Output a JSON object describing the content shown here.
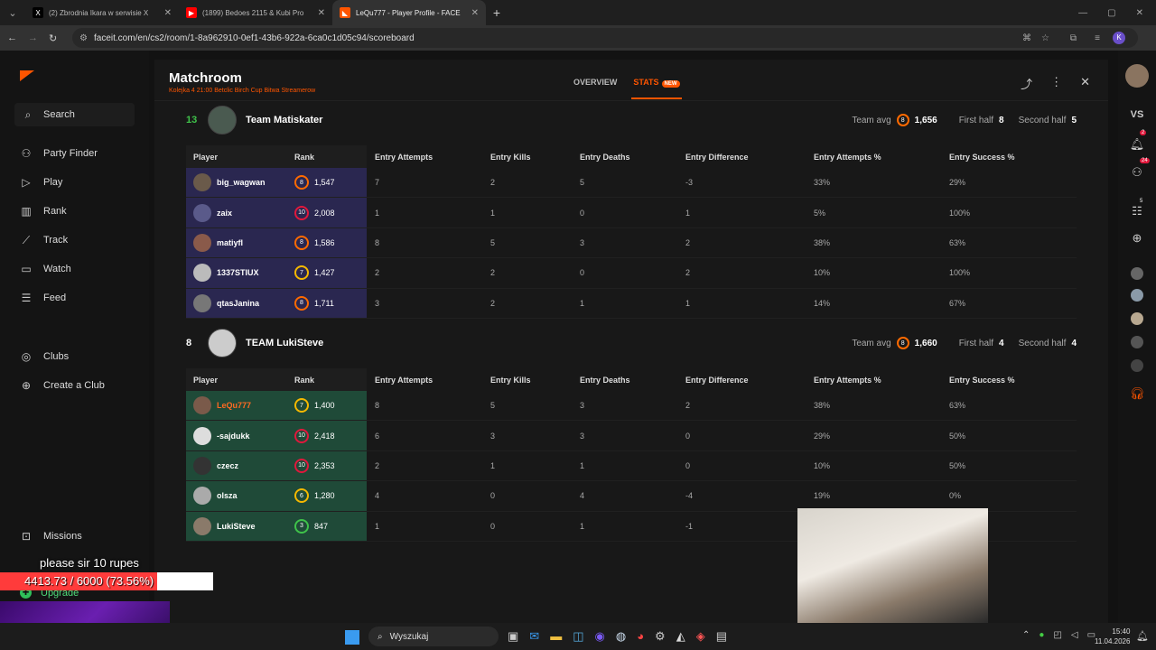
{
  "browser": {
    "tabs": [
      {
        "title": "(2) Zbrodnia Ikara w serwisie X",
        "icon": "x-icon"
      },
      {
        "title": "(1899) Bedoes 2115 & Kubi Pro",
        "icon": "youtube-icon"
      },
      {
        "title": "LeQu777 - Player Profile - FACE",
        "icon": "faceit-icon",
        "active": true
      }
    ],
    "url": "faceit.com/en/cs2/room/1-8a962910-0ef1-43b6-922a-6ca0c1d05c94/scoreboard",
    "new_tab": "+"
  },
  "sidebar": {
    "search": "Search",
    "items": [
      "Party Finder",
      "Play",
      "Rank",
      "Track",
      "Watch",
      "Feed"
    ],
    "clubs": "Clubs",
    "create_club": "Create a Club",
    "missions": "Missions",
    "upgrade": "Upgrade"
  },
  "matchroom": {
    "title": "Matchroom",
    "subtitle": "Kolejka 4 21:00 Betclic Birch Cup Bitwa Streamerow",
    "tabs": {
      "overview": "OVERVIEW",
      "stats": "STATS",
      "new_badge": "NEW"
    }
  },
  "columns": [
    "Player",
    "Rank",
    "Entry Attempts",
    "Entry Kills",
    "Entry Deaths",
    "Entry Difference",
    "Entry Attempts %",
    "Entry Success %"
  ],
  "teams": [
    {
      "score": "13",
      "name": "Team Matiskater",
      "avg_label": "Team avg",
      "avg_level": "8",
      "avg_elo": "1,656",
      "first_half_label": "First half",
      "first_half": "8",
      "second_half_label": "Second half",
      "second_half": "5",
      "players": [
        {
          "name": "big_wagwan",
          "level": "8",
          "elo": "1,547",
          "att": "7",
          "kills": "2",
          "deaths": "5",
          "diff": "-3",
          "attp": "33%",
          "succ": "29%"
        },
        {
          "name": "zaix",
          "level": "10",
          "elo": "2,008",
          "att": "1",
          "kills": "1",
          "deaths": "0",
          "diff": "1",
          "attp": "5%",
          "succ": "100%"
        },
        {
          "name": "matiyfl",
          "level": "8",
          "elo": "1,586",
          "att": "8",
          "kills": "5",
          "deaths": "3",
          "diff": "2",
          "attp": "38%",
          "succ": "63%"
        },
        {
          "name": "1337STIUX",
          "level": "7",
          "elo": "1,427",
          "att": "2",
          "kills": "2",
          "deaths": "0",
          "diff": "2",
          "attp": "10%",
          "succ": "100%"
        },
        {
          "name": "qtasJanina",
          "level": "8",
          "elo": "1,711",
          "att": "3",
          "kills": "2",
          "deaths": "1",
          "diff": "1",
          "attp": "14%",
          "succ": "67%"
        }
      ]
    },
    {
      "score": "8",
      "name": "TEAM LukiSteve",
      "avg_label": "Team avg",
      "avg_level": "8",
      "avg_elo": "1,660",
      "first_half_label": "First half",
      "first_half": "4",
      "second_half_label": "Second half",
      "second_half": "4",
      "players": [
        {
          "name": "LeQu777",
          "level": "7",
          "elo": "1,400",
          "att": "8",
          "kills": "5",
          "deaths": "3",
          "diff": "2",
          "attp": "38%",
          "succ": "63%"
        },
        {
          "name": "-sajdukk",
          "level": "10",
          "elo": "2,418",
          "att": "6",
          "kills": "3",
          "deaths": "3",
          "diff": "0",
          "attp": "29%",
          "succ": "50%"
        },
        {
          "name": "czecz",
          "level": "10",
          "elo": "2,353",
          "att": "2",
          "kills": "1",
          "deaths": "1",
          "diff": "0",
          "attp": "10%",
          "succ": "50%"
        },
        {
          "name": "olsza",
          "level": "6",
          "elo": "1,280",
          "att": "4",
          "kills": "0",
          "deaths": "4",
          "diff": "-4",
          "attp": "19%",
          "succ": "0%"
        },
        {
          "name": "LukiSteve",
          "level": "3",
          "elo": "847",
          "att": "1",
          "kills": "0",
          "deaths": "1",
          "diff": "-1",
          "attp": "",
          "succ": ""
        }
      ]
    }
  ],
  "right_sidebar": {
    "vs": "VS",
    "bell_badge": "2",
    "friends_badge": "24",
    "party_badge": "5"
  },
  "overlay": {
    "message": "please sir 10 rupes",
    "progress_text": "4413.73 / 6000 (73.56%)",
    "progress": 0.7356
  },
  "taskbar": {
    "search": "Wyszukaj",
    "time": "15:40",
    "date": "11.04.2026"
  },
  "colors": {
    "accent": "#ff5500",
    "team1_row": "#2a2750",
    "team2_row": "#1f4a38"
  }
}
